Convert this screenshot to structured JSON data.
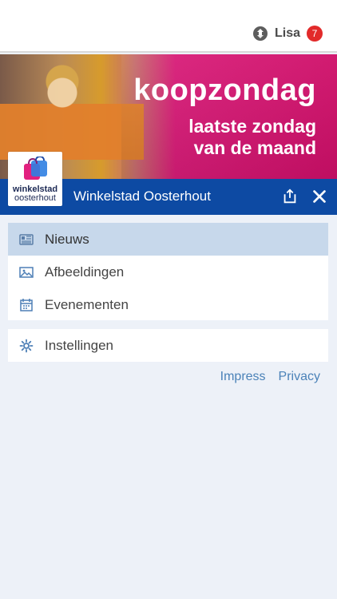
{
  "header": {
    "user_name": "Lisa",
    "notification_count": "7",
    "user_icon": "cycle-icon"
  },
  "banner": {
    "line1": "koopzondag",
    "line2": "laatste zondag",
    "line3": "van de maand"
  },
  "logo": {
    "line1": "winkelstad",
    "line2": "oosterhout"
  },
  "site_bar": {
    "title": "Winkelstad Oosterhout",
    "share_icon": "share-icon",
    "close_icon": "close-icon"
  },
  "menu": {
    "items": [
      {
        "label": "Nieuws",
        "icon": "newspaper-icon",
        "active": true
      },
      {
        "label": "Afbeeldingen",
        "icon": "image-icon",
        "active": false
      },
      {
        "label": "Evenementen",
        "icon": "calendar-icon",
        "active": false
      }
    ],
    "settings": {
      "label": "Instellingen",
      "icon": "gear-icon"
    }
  },
  "footer": {
    "links": [
      "Impress",
      "Privacy"
    ]
  },
  "colors": {
    "brand_blue": "#0d4aa3",
    "active_menu": "#c7d8eb",
    "badge_red": "#e22a2a",
    "banner_pink": "#d81c78",
    "footer_link": "#4b82b8"
  }
}
